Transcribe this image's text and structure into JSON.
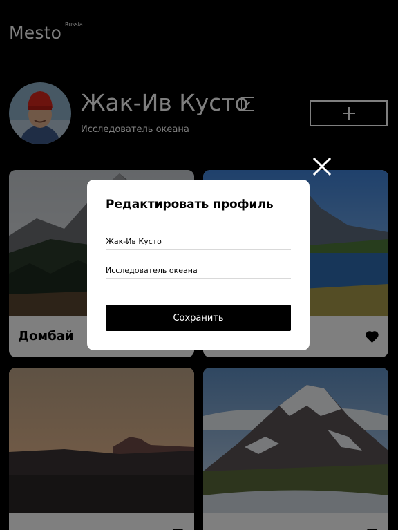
{
  "header": {
    "logo": "Mesto",
    "logo_sub": "Russia"
  },
  "profile": {
    "name": "Жак-Ив Кусто",
    "about": "Исследователь океана",
    "edit_icon": "pencil-icon",
    "add_icon": "plus-icon"
  },
  "cards": [
    {
      "title": "Домбай",
      "liked": false
    },
    {
      "title": "",
      "liked": true
    },
    {
      "title": "",
      "liked": false
    },
    {
      "title": "",
      "liked": false
    }
  ],
  "popup": {
    "title": "Редактировать профиль",
    "name_value": "Жак-Ив Кусто",
    "about_value": "Исследователь океана",
    "save_label": "Сохранить",
    "close_icon": "close-icon"
  }
}
